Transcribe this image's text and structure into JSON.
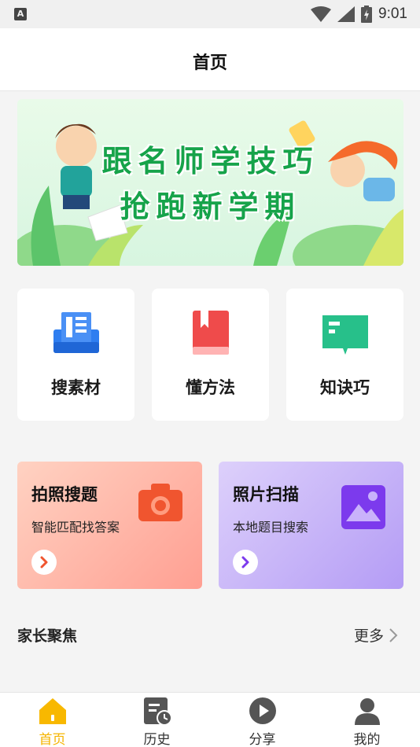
{
  "status_bar": {
    "time": "9:01"
  },
  "header": {
    "title": "首页"
  },
  "banner": {
    "line1": "跟名师学技巧",
    "line2": "抢跑新学期"
  },
  "tiles": [
    {
      "label": "搜素材",
      "icon": "document-stack-icon",
      "color": "#2f7ef0"
    },
    {
      "label": "懂方法",
      "icon": "book-icon",
      "color": "#ef4b4b"
    },
    {
      "label": "知诀巧",
      "icon": "open-book-icon",
      "color": "#27c08a"
    }
  ],
  "cards": [
    {
      "title": "拍照搜题",
      "subtitle": "智能匹配找答案",
      "icon": "camera-icon",
      "accent": "#f0552f"
    },
    {
      "title": "照片扫描",
      "subtitle": "本地题目搜索",
      "icon": "image-icon",
      "accent": "#7c3aed"
    }
  ],
  "section": {
    "title": "家长聚焦",
    "more": "更多"
  },
  "tabbar": [
    {
      "label": "首页",
      "icon": "home-icon",
      "active": true
    },
    {
      "label": "历史",
      "icon": "history-icon",
      "active": false
    },
    {
      "label": "分享",
      "icon": "play-icon",
      "active": false
    },
    {
      "label": "我的",
      "icon": "user-icon",
      "active": false
    }
  ]
}
